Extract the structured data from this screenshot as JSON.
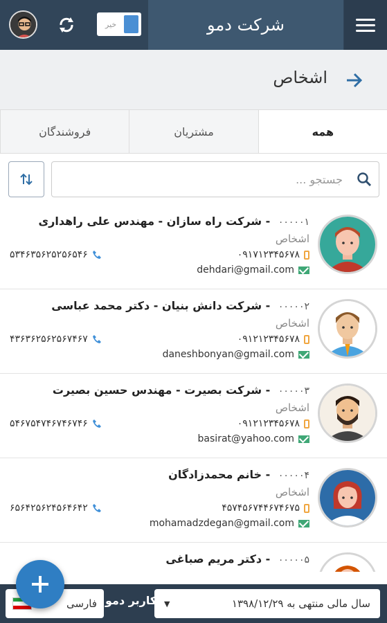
{
  "header": {
    "title": "شرکت دمو",
    "toggle_label": "خیر"
  },
  "page": {
    "title": "اشخاص"
  },
  "tabs": [
    {
      "label": "همه",
      "active": true
    },
    {
      "label": "مشتریان",
      "active": false
    },
    {
      "label": "فروشندگان",
      "active": false
    }
  ],
  "search": {
    "placeholder": "جستجو ..."
  },
  "people": [
    {
      "code": "۰۰۰۰۰۱",
      "name": "شرکت راه سازان - مهندس علی راهداری",
      "category": "اشخاص",
      "mobile": "۰۹۱۷۱۲۳۴۵۶۷۸",
      "phone": "۵۳۴۶۳۵۶۲۵۲۵۶۵۴۶",
      "email": "dehdari@gmail.com"
    },
    {
      "code": "۰۰۰۰۰۲",
      "name": "شرکت دانش بنیان - دکتر محمد عباسی",
      "category": "اشخاص",
      "mobile": "۰۹۱۲۱۲۳۴۵۶۷۸",
      "phone": "۴۳۶۳۶۲۵۶۲۵۶۷۴۶۷",
      "email": "daneshbonyan@gmail.com"
    },
    {
      "code": "۰۰۰۰۰۳",
      "name": "شرکت بصیرت - مهندس حسین بصیرت",
      "category": "اشخاص",
      "mobile": "۰۹۱۲۱۲۳۴۵۶۷۸",
      "phone": "۵۴۶۷۵۴۷۴۶۷۴۶۷۴۶",
      "email": "basirat@yahoo.com"
    },
    {
      "code": "۰۰۰۰۰۴",
      "name": "خانم محمدزادگان",
      "category": "اشخاص",
      "mobile": "۴۵۷۴۵۶۷۴۴۶۷۴۶۷۵",
      "phone": "۶۵۶۴۲۵۶۲۴۵۶۴۶۴۲",
      "email": "mohamadzdegan@gmail.com"
    },
    {
      "code": "۰۰۰۰۰۵",
      "name": "دکتر مریم صباغی",
      "category": "",
      "mobile": "",
      "phone": "",
      "email": ""
    }
  ],
  "footer": {
    "fiscal_year": "سال مالی منتهی به ۱۳۹۸/۱۲/۲۹",
    "user": "کاربر دمو",
    "language": "فارسی"
  },
  "colors": {
    "header_bg": "#314559",
    "title_bg": "#3e5870",
    "accent": "#2f7ec3",
    "footer_bg": "#2d3e50"
  }
}
